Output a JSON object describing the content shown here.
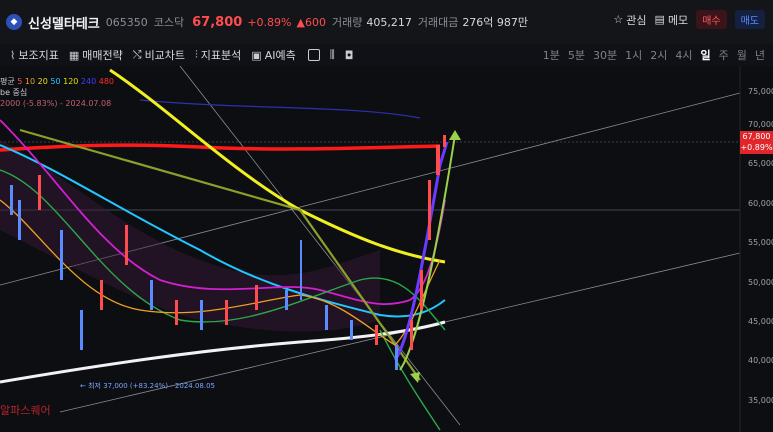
{
  "header": {
    "stock_name": "신성델타테크",
    "code": "065350",
    "market": "코스닥",
    "price": "67,800",
    "change_pct": "+0.89%",
    "change_abs": "▲600",
    "volume_label": "거래량",
    "volume": "405,217",
    "amount_label": "거래대금",
    "amount": "276억 987만",
    "watch_label": "관심",
    "memo_label": "메모",
    "buy_label": "매수",
    "sell_label": "매도"
  },
  "toolbar": {
    "tools": [
      "보조지표",
      "매매전략",
      "비교차트",
      "지표분석",
      "AI예측"
    ],
    "periods": [
      "1분",
      "5분",
      "30분",
      "1시",
      "2시",
      "4시",
      "일",
      "주",
      "월",
      "년"
    ],
    "active_period": "일"
  },
  "legend": {
    "ma_label": "평균",
    "ma_periods": [
      "5",
      "10",
      "20",
      "50",
      "120",
      "240",
      "480"
    ],
    "ma_colors": [
      "#ff4d4f",
      "#f0a020",
      "#e6e020",
      "#22c7ff",
      "#e0e000",
      "#3f3fff",
      "#ff2a2a"
    ],
    "line2": "be  중심",
    "line3": "2000 (-5.83%) - 2024.07.08"
  },
  "y_axis": {
    "ticks": [
      "75,000",
      "70,000",
      "65,000",
      "60,000",
      "55,000",
      "50,000",
      "45,000",
      "40,000",
      "35,000"
    ]
  },
  "current_tag": {
    "price": "67,800",
    "pct": "+0.89%"
  },
  "low_note": "← 최저 37,000 (+83.24%) - 2024.08.05",
  "watermark": "알파스퀘어",
  "colors": {
    "up": "#ff4d4f",
    "down": "#5b8cff",
    "background": "#0d0e12"
  }
}
